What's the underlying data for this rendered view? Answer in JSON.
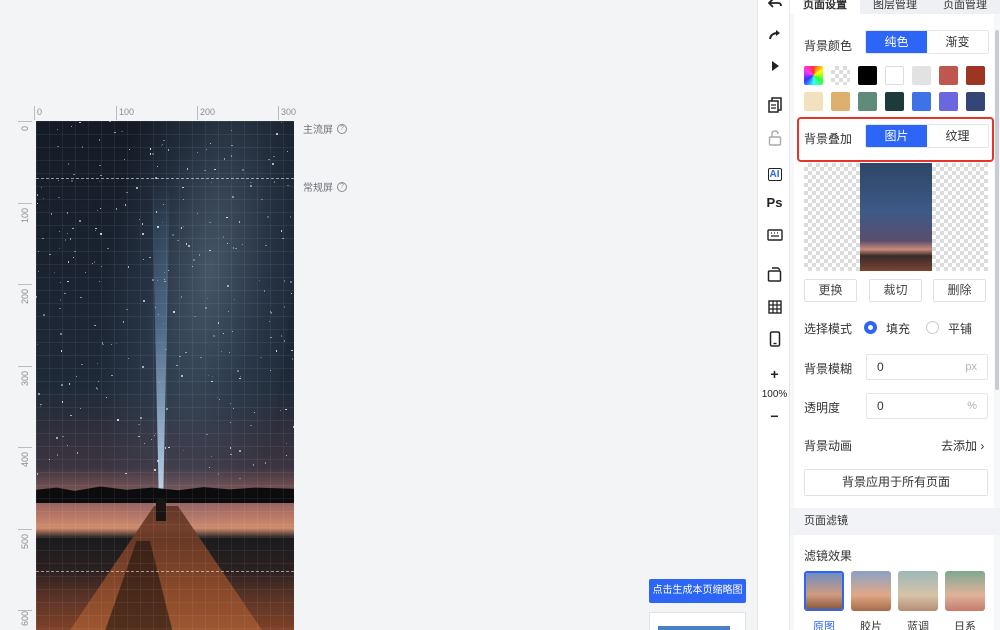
{
  "canvas": {
    "ruler_h_labels": [
      "0",
      "100",
      "200",
      "300"
    ],
    "ruler_v_labels": [
      "0",
      "100",
      "200",
      "300",
      "400",
      "500",
      "600"
    ],
    "screen_labels": [
      {
        "text": "主流屏"
      },
      {
        "text": "常规屏"
      }
    ],
    "thumbnail_button": "点击生成本页缩略图"
  },
  "toolbar": {
    "zoom_level": "100%",
    "items": [
      "undo-icon",
      "redo-icon",
      "play-icon",
      "copy-page-icon",
      "lock-icon",
      "ai-icon",
      "ps-icon",
      "keyboard-icon",
      "replace-icon",
      "grid-icon",
      "phone-icon",
      "zoom-in-icon",
      "zoom-out-icon"
    ],
    "ai_label": "AI",
    "ps_label": "Ps",
    "plus": "+",
    "minus": "−"
  },
  "panel": {
    "tabs": [
      {
        "label": "页面设置",
        "active": true
      },
      {
        "label": "图层管理",
        "active": false
      },
      {
        "label": "页面管理",
        "active": false
      }
    ],
    "bg_color": {
      "label": "背景颜色",
      "options": [
        {
          "label": "纯色",
          "active": true
        },
        {
          "label": "渐变",
          "active": false
        }
      ],
      "swatches": [
        "rainbow",
        "transparent",
        "#000000",
        "#ffffff",
        "#e2e2e2",
        "#c0574f",
        "#9e3523",
        "#f3e1be",
        "#deb06d",
        "#5f8c7a",
        "#1c3b3a",
        "#3e73e8",
        "#6a67df",
        "#344675"
      ]
    },
    "bg_overlay": {
      "label": "背景叠加",
      "options": [
        {
          "label": "图片",
          "active": true
        },
        {
          "label": "纹理",
          "active": false
        }
      ],
      "highlight_color": "#e5352b"
    },
    "image_actions": [
      "更换",
      "裁切",
      "删除"
    ],
    "mode": {
      "label": "选择模式",
      "options": [
        {
          "label": "填充",
          "selected": true
        },
        {
          "label": "平铺",
          "selected": false
        }
      ]
    },
    "blur": {
      "label": "背景模糊",
      "value": "0",
      "unit": "px"
    },
    "opacity": {
      "label": "透明度",
      "value": "0",
      "unit": "%"
    },
    "animation": {
      "label": "背景动画",
      "action": "去添加"
    },
    "apply_all": "背景应用于所有页面",
    "filter_section": "页面滤镜",
    "filter_label": "滤镜效果",
    "filters": [
      {
        "label": "原图",
        "selected": true
      },
      {
        "label": "胶片",
        "selected": false
      },
      {
        "label": "蓝调",
        "selected": false
      },
      {
        "label": "日系",
        "selected": false
      }
    ],
    "accent_color": "#2d66f6"
  }
}
